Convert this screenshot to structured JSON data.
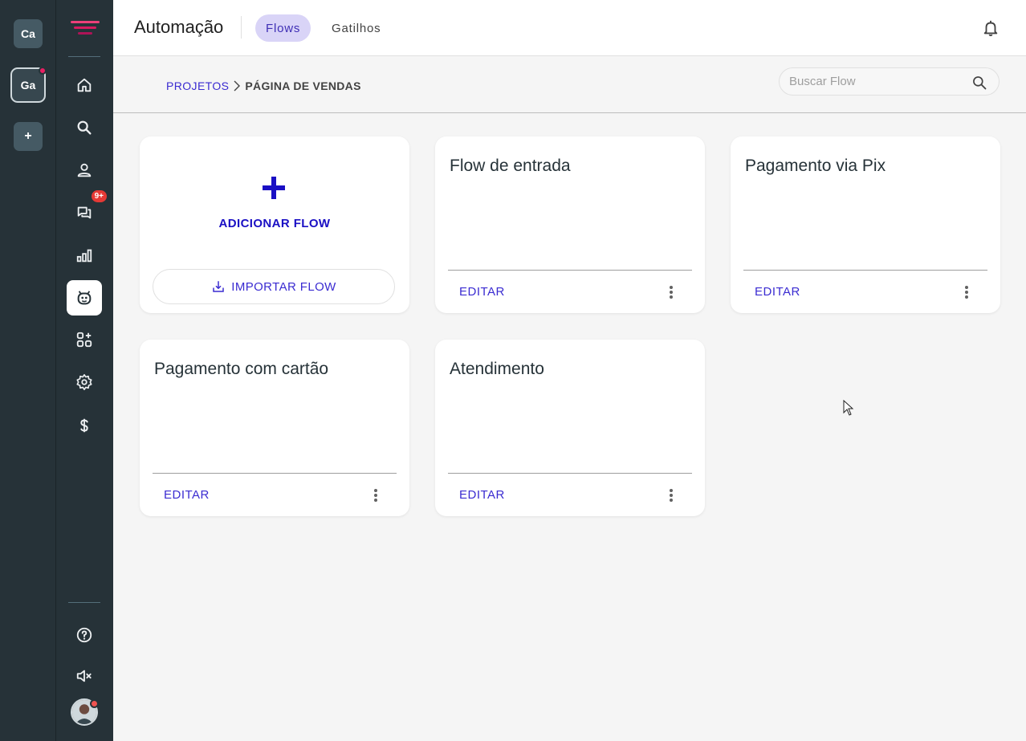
{
  "workspaces": [
    {
      "label": "Ca",
      "active": false
    },
    {
      "label": "Ga",
      "active": true,
      "notification": true
    },
    {
      "label": "+",
      "is_add": true
    }
  ],
  "nav": {
    "items": [
      {
        "name": "home",
        "icon": "home-icon"
      },
      {
        "name": "search",
        "icon": "search-icon"
      },
      {
        "name": "contacts",
        "icon": "person-icon"
      },
      {
        "name": "chats",
        "icon": "chat-icon",
        "badge": "9+"
      },
      {
        "name": "reports",
        "icon": "bar-chart-icon"
      },
      {
        "name": "automation",
        "icon": "bot-icon",
        "active": true
      },
      {
        "name": "integrations",
        "icon": "apps-add-icon"
      },
      {
        "name": "settings",
        "icon": "gear-icon"
      },
      {
        "name": "billing",
        "icon": "dollar-icon"
      }
    ],
    "bottom": [
      {
        "name": "help",
        "icon": "help-icon"
      },
      {
        "name": "sound",
        "icon": "volume-mute-icon"
      }
    ]
  },
  "header": {
    "title": "Automação",
    "tabs": [
      {
        "label": "Flows",
        "selected": true
      },
      {
        "label": "Gatilhos",
        "selected": false
      }
    ]
  },
  "breadcrumb": {
    "parent": "PROJETOS",
    "current": "PÁGINA DE VENDAS"
  },
  "search": {
    "placeholder": "Buscar Flow",
    "value": ""
  },
  "add_card": {
    "add_label": "ADICIONAR FLOW",
    "import_label": "IMPORTAR FLOW"
  },
  "flows": [
    {
      "title": "Flow de entrada",
      "edit_label": "EDITAR"
    },
    {
      "title": "Pagamento via Pix",
      "edit_label": "EDITAR"
    },
    {
      "title": "Pagamento com cartão",
      "edit_label": "EDITAR"
    },
    {
      "title": "Atendimento",
      "edit_label": "EDITAR"
    }
  ],
  "colors": {
    "sidebar": "#263238",
    "accent": "#3a2bd1",
    "tab_selected_bg": "#d9d4f7",
    "badge": "#e53935"
  }
}
